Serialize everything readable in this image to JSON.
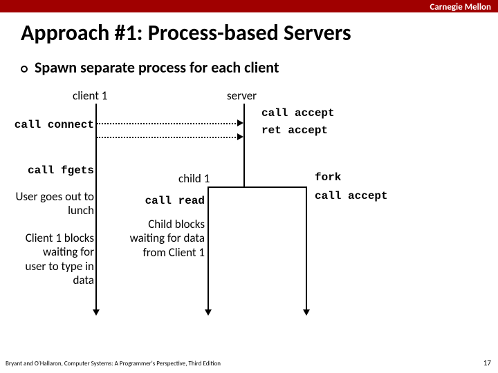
{
  "brand": "Carnegie Mellon",
  "title": "Approach #1: Process-based Servers",
  "bullet": "Spawn separate process for each client",
  "labels": {
    "client1": "client 1",
    "server": "server",
    "call_connect": "call connect",
    "call_accept": "call accept",
    "ret_accept": "ret accept",
    "call_fgets": "call fgets",
    "child1": "child 1",
    "fork": "fork",
    "call_accept2": "call accept",
    "call_read": "call read",
    "user_lunch": "User goes out to lunch",
    "client1_blocks": "Client 1 blocks waiting for user to type in data",
    "child_blocks": "Child blocks waiting for data from Client 1"
  },
  "footer": "Bryant and O'Hallaron, Computer Systems: A Programmer's Perspective, Third Edition",
  "page": "17"
}
